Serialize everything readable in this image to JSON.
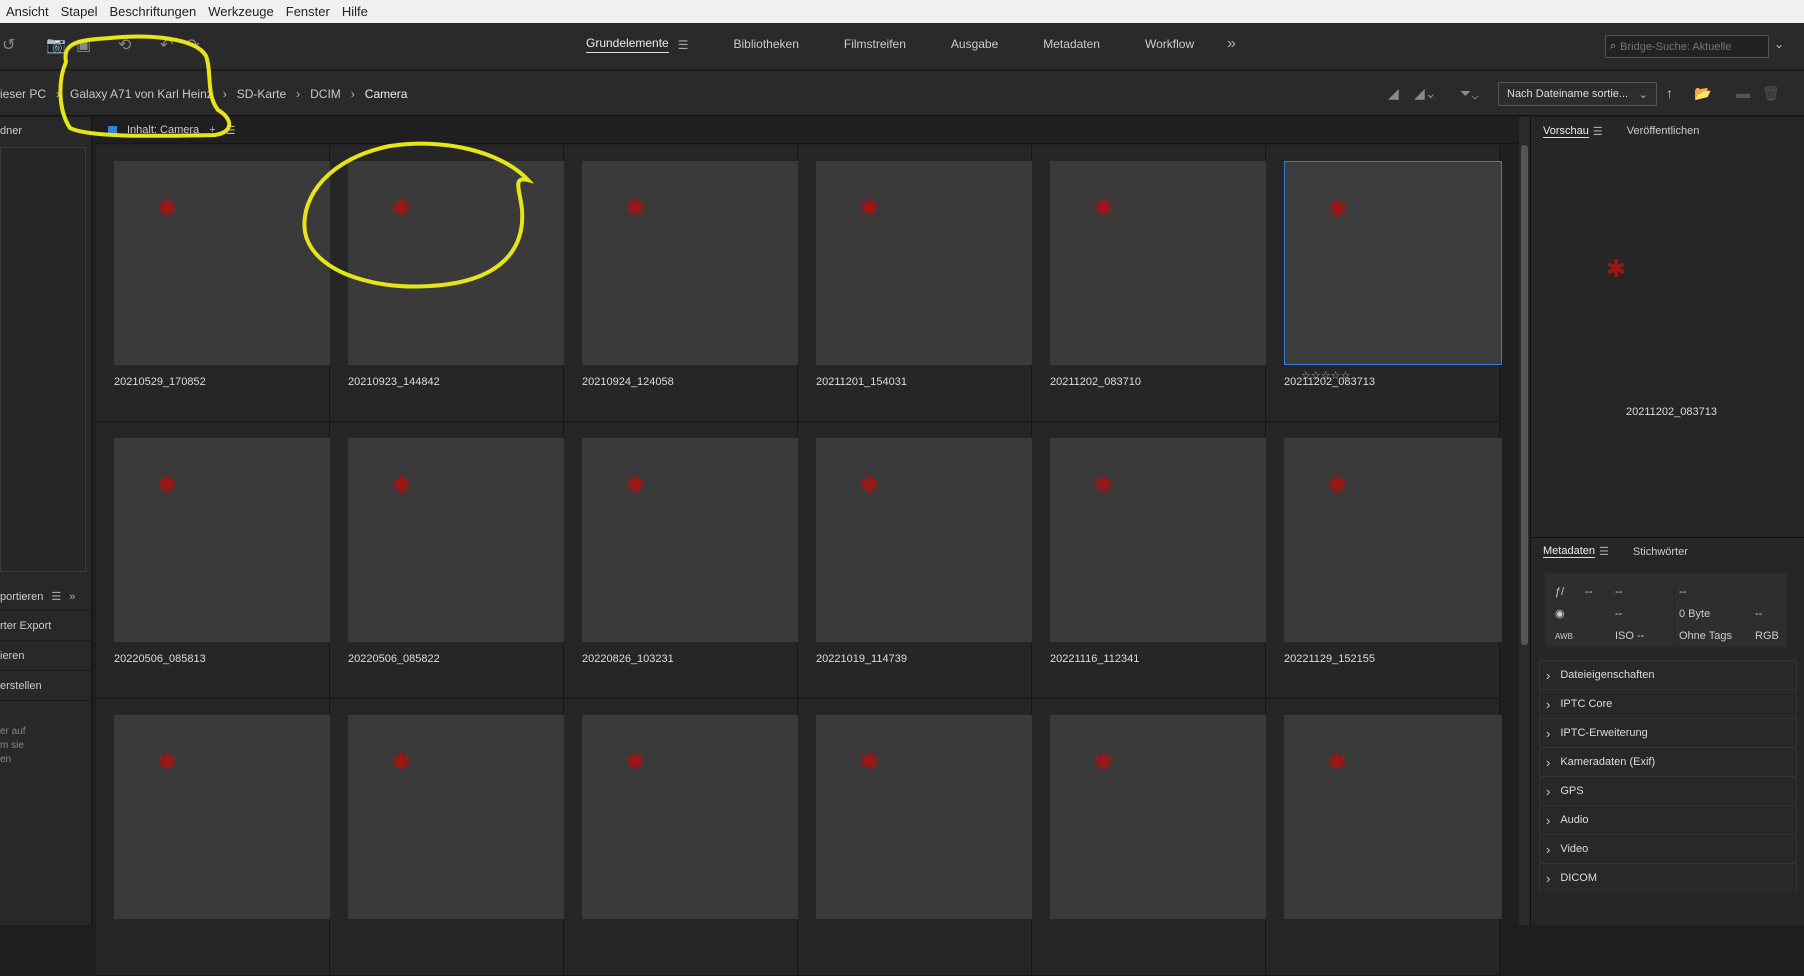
{
  "menu": [
    "Ansicht",
    "Stapel",
    "Beschriftungen",
    "Werkzeuge",
    "Fenster",
    "Hilfe"
  ],
  "workspaces": {
    "items": [
      "Grundelemente",
      "Bibliotheken",
      "Filmstreifen",
      "Ausgabe",
      "Metadaten",
      "Workflow"
    ],
    "active": "Grundelemente"
  },
  "search": {
    "placeholder": "Bridge-Suche: Aktuelle"
  },
  "breadcrumb": [
    "ieser PC",
    "Galaxy A71 von Karl Heinz",
    "SD-Karte",
    "DCIM",
    "Camera"
  ],
  "sort": {
    "label": "Nach Dateiname sortie..."
  },
  "left": {
    "folders_label": "dner",
    "export_label": "portieren",
    "items": [
      "rter Export",
      "ieren",
      "erstellen"
    ],
    "note": [
      "er auf",
      "m sie",
      "en"
    ]
  },
  "content": {
    "header": "Inhalt: Camera"
  },
  "files": [
    "20210529_170852",
    "20210923_144842",
    "20210924_124058",
    "20211201_154031",
    "20211202_083710",
    "20211202_083713",
    "20220506_085813",
    "20220506_085822",
    "20220826_103231",
    "20221019_114739",
    "20221116_112341",
    "20221129_152155",
    "",
    "",
    "",
    "",
    "",
    ""
  ],
  "selected_index": 5,
  "stars": "☆☆☆☆☆",
  "preview": {
    "tabs": [
      "Vorschau",
      "Veröffentlichen"
    ],
    "filename": "20211202_083713"
  },
  "metadata": {
    "tabs": [
      "Metadaten",
      "Stichwörter"
    ],
    "left_rows": [
      [
        "ƒ/",
        "--",
        "--"
      ],
      [
        "◉",
        "",
        "--"
      ],
      [
        "AWB",
        "",
        "ISO --"
      ]
    ],
    "right_rows": [
      [
        "--",
        ""
      ],
      [
        "0 Byte",
        "--"
      ],
      [
        "Ohne Tags",
        "RGB"
      ]
    ],
    "sections": [
      "Dateieigenschaften",
      "IPTC Core",
      "IPTC-Erweiterung",
      "Kameradaten (Exif)",
      "GPS",
      "Audio",
      "Video",
      "DICOM"
    ]
  },
  "colors": {
    "accent": "#3d7ae0",
    "annotation": "#e5e51a",
    "file_icon": "#a11414"
  }
}
